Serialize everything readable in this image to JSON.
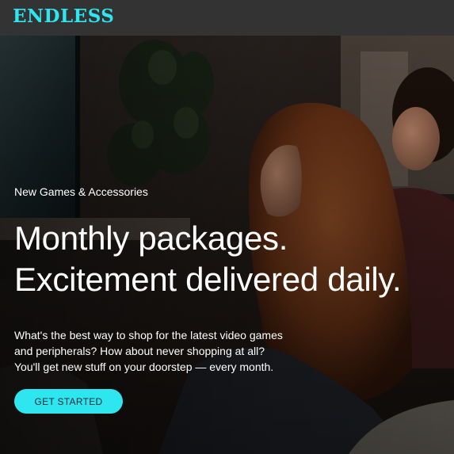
{
  "header": {
    "logo_text": "ENDLESS",
    "background": "#333333",
    "accent": "#2ee6f0"
  },
  "hero": {
    "eyebrow": "New Games & Accessories",
    "headline_line1": "Monthly packages.",
    "headline_line2": "Excitement delivered daily.",
    "description_line1": "What's the best way to shop for the latest video games",
    "description_line2": "and peripherals? How about never shopping at all?",
    "description_line3": "You'll get new stuff on your doorstep — every month.",
    "cta_label": "GET STARTED",
    "cta_color": "#2ee6f0",
    "background_image": "photo-of-people-playing-video-games-on-couch"
  }
}
